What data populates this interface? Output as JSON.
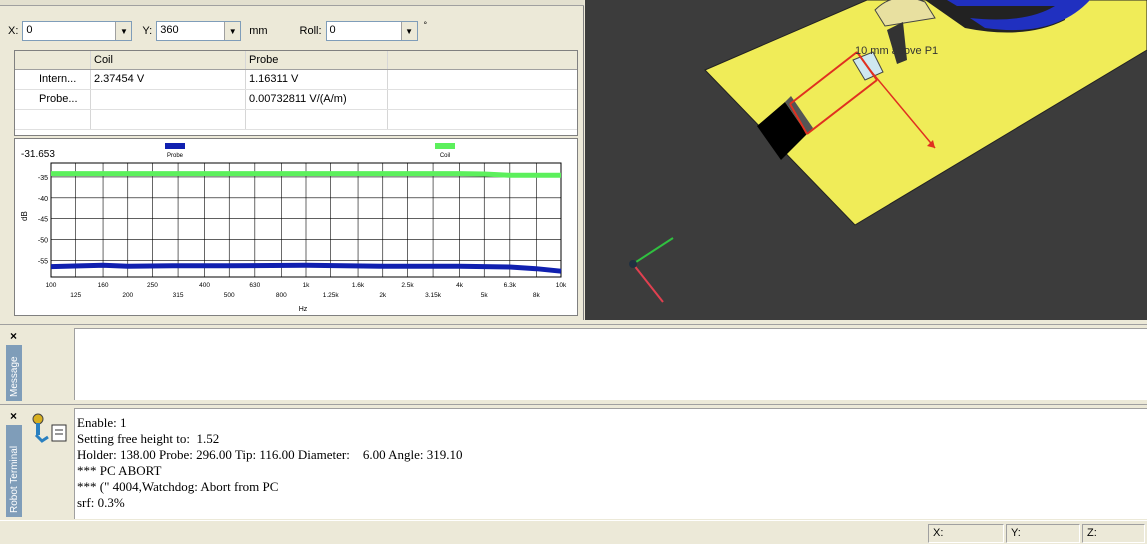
{
  "coords": {
    "x_label": "X:",
    "x_value": "0",
    "y_label": "Y:",
    "y_value": "360",
    "unit": "mm",
    "roll_label": "Roll:",
    "roll_value": "0",
    "degree": "°"
  },
  "table": {
    "headers": [
      "",
      "Coil",
      "Probe",
      ""
    ],
    "rows": [
      [
        "Intern...",
        "2.37454 V",
        "1.16311 V"
      ],
      [
        "Probe...",
        "",
        "0.00732811 V/(A/m)"
      ],
      [
        "",
        "",
        ""
      ]
    ]
  },
  "chart_data": {
    "type": "line",
    "top_value_label": "-31.653",
    "ylabel": "dB",
    "xlabel": "Hz",
    "x_scale": "log",
    "ylim": [
      -59,
      -31.653
    ],
    "xlim": [
      100,
      10000
    ],
    "yticks": [
      -35,
      -40,
      -45,
      -50,
      -55
    ],
    "ytick_labels": [
      "-35",
      "-40",
      "-45",
      "-50",
      "-55"
    ],
    "xticks_top": [
      {
        "v": 100,
        "l": "100"
      },
      {
        "v": 160,
        "l": "160"
      },
      {
        "v": 250,
        "l": "250"
      },
      {
        "v": 400,
        "l": "400"
      },
      {
        "v": 630,
        "l": "630"
      },
      {
        "v": 1000,
        "l": "1k"
      },
      {
        "v": 1600,
        "l": "1.6k"
      },
      {
        "v": 2500,
        "l": "2.5k"
      },
      {
        "v": 4000,
        "l": "4k"
      },
      {
        "v": 6300,
        "l": "6.3k"
      },
      {
        "v": 10000,
        "l": "10k"
      }
    ],
    "xticks_bottom": [
      {
        "v": 125,
        "l": "125"
      },
      {
        "v": 200,
        "l": "200"
      },
      {
        "v": 315,
        "l": "315"
      },
      {
        "v": 500,
        "l": "500"
      },
      {
        "v": 800,
        "l": "800"
      },
      {
        "v": 1250,
        "l": "1.25k"
      },
      {
        "v": 2000,
        "l": "2k"
      },
      {
        "v": 3150,
        "l": "3.15k"
      },
      {
        "v": 5000,
        "l": "5k"
      },
      {
        "v": 8000,
        "l": "8k"
      }
    ],
    "series": [
      {
        "name": "Coil",
        "color": "#5cf05c",
        "x": [
          100,
          200,
          500,
          1000,
          2000,
          4000,
          5000,
          6300,
          10000
        ],
        "y": [
          -34.2,
          -34.2,
          -34.2,
          -34.2,
          -34.2,
          -34.2,
          -34.3,
          -34.6,
          -34.6
        ]
      },
      {
        "name": "Probe",
        "color": "#1020b0",
        "x": [
          100,
          160,
          200,
          300,
          500,
          1000,
          2000,
          4000,
          6300,
          8000,
          10000
        ],
        "y": [
          -56.5,
          -56.2,
          -56.4,
          -56.3,
          -56.3,
          -56.2,
          -56.4,
          -56.4,
          -56.6,
          -57.0,
          -57.6
        ]
      }
    ]
  },
  "view3d": {
    "label": "10 mm above P1",
    "background": "#3c3c3c",
    "plate_color": "#f0ec58"
  },
  "message_pane": {
    "tab_label": "Message",
    "close": "×"
  },
  "terminal": {
    "tab_label": "Robot Terminal",
    "close": "×",
    "lines": [
      "Enable: 1",
      "Setting free height to:  1.52",
      "Holder: 138.00 Probe: 296.00 Tip: 116.00 Diameter:    6.00 Angle: 319.10",
      "*** PC ABORT",
      "*** (\" 4004,Watchdog: Abort from PC",
      "srf: 0.3%"
    ]
  },
  "status_bar": {
    "x_label": "X:",
    "y_label": "Y:",
    "z_label": "Z:"
  }
}
